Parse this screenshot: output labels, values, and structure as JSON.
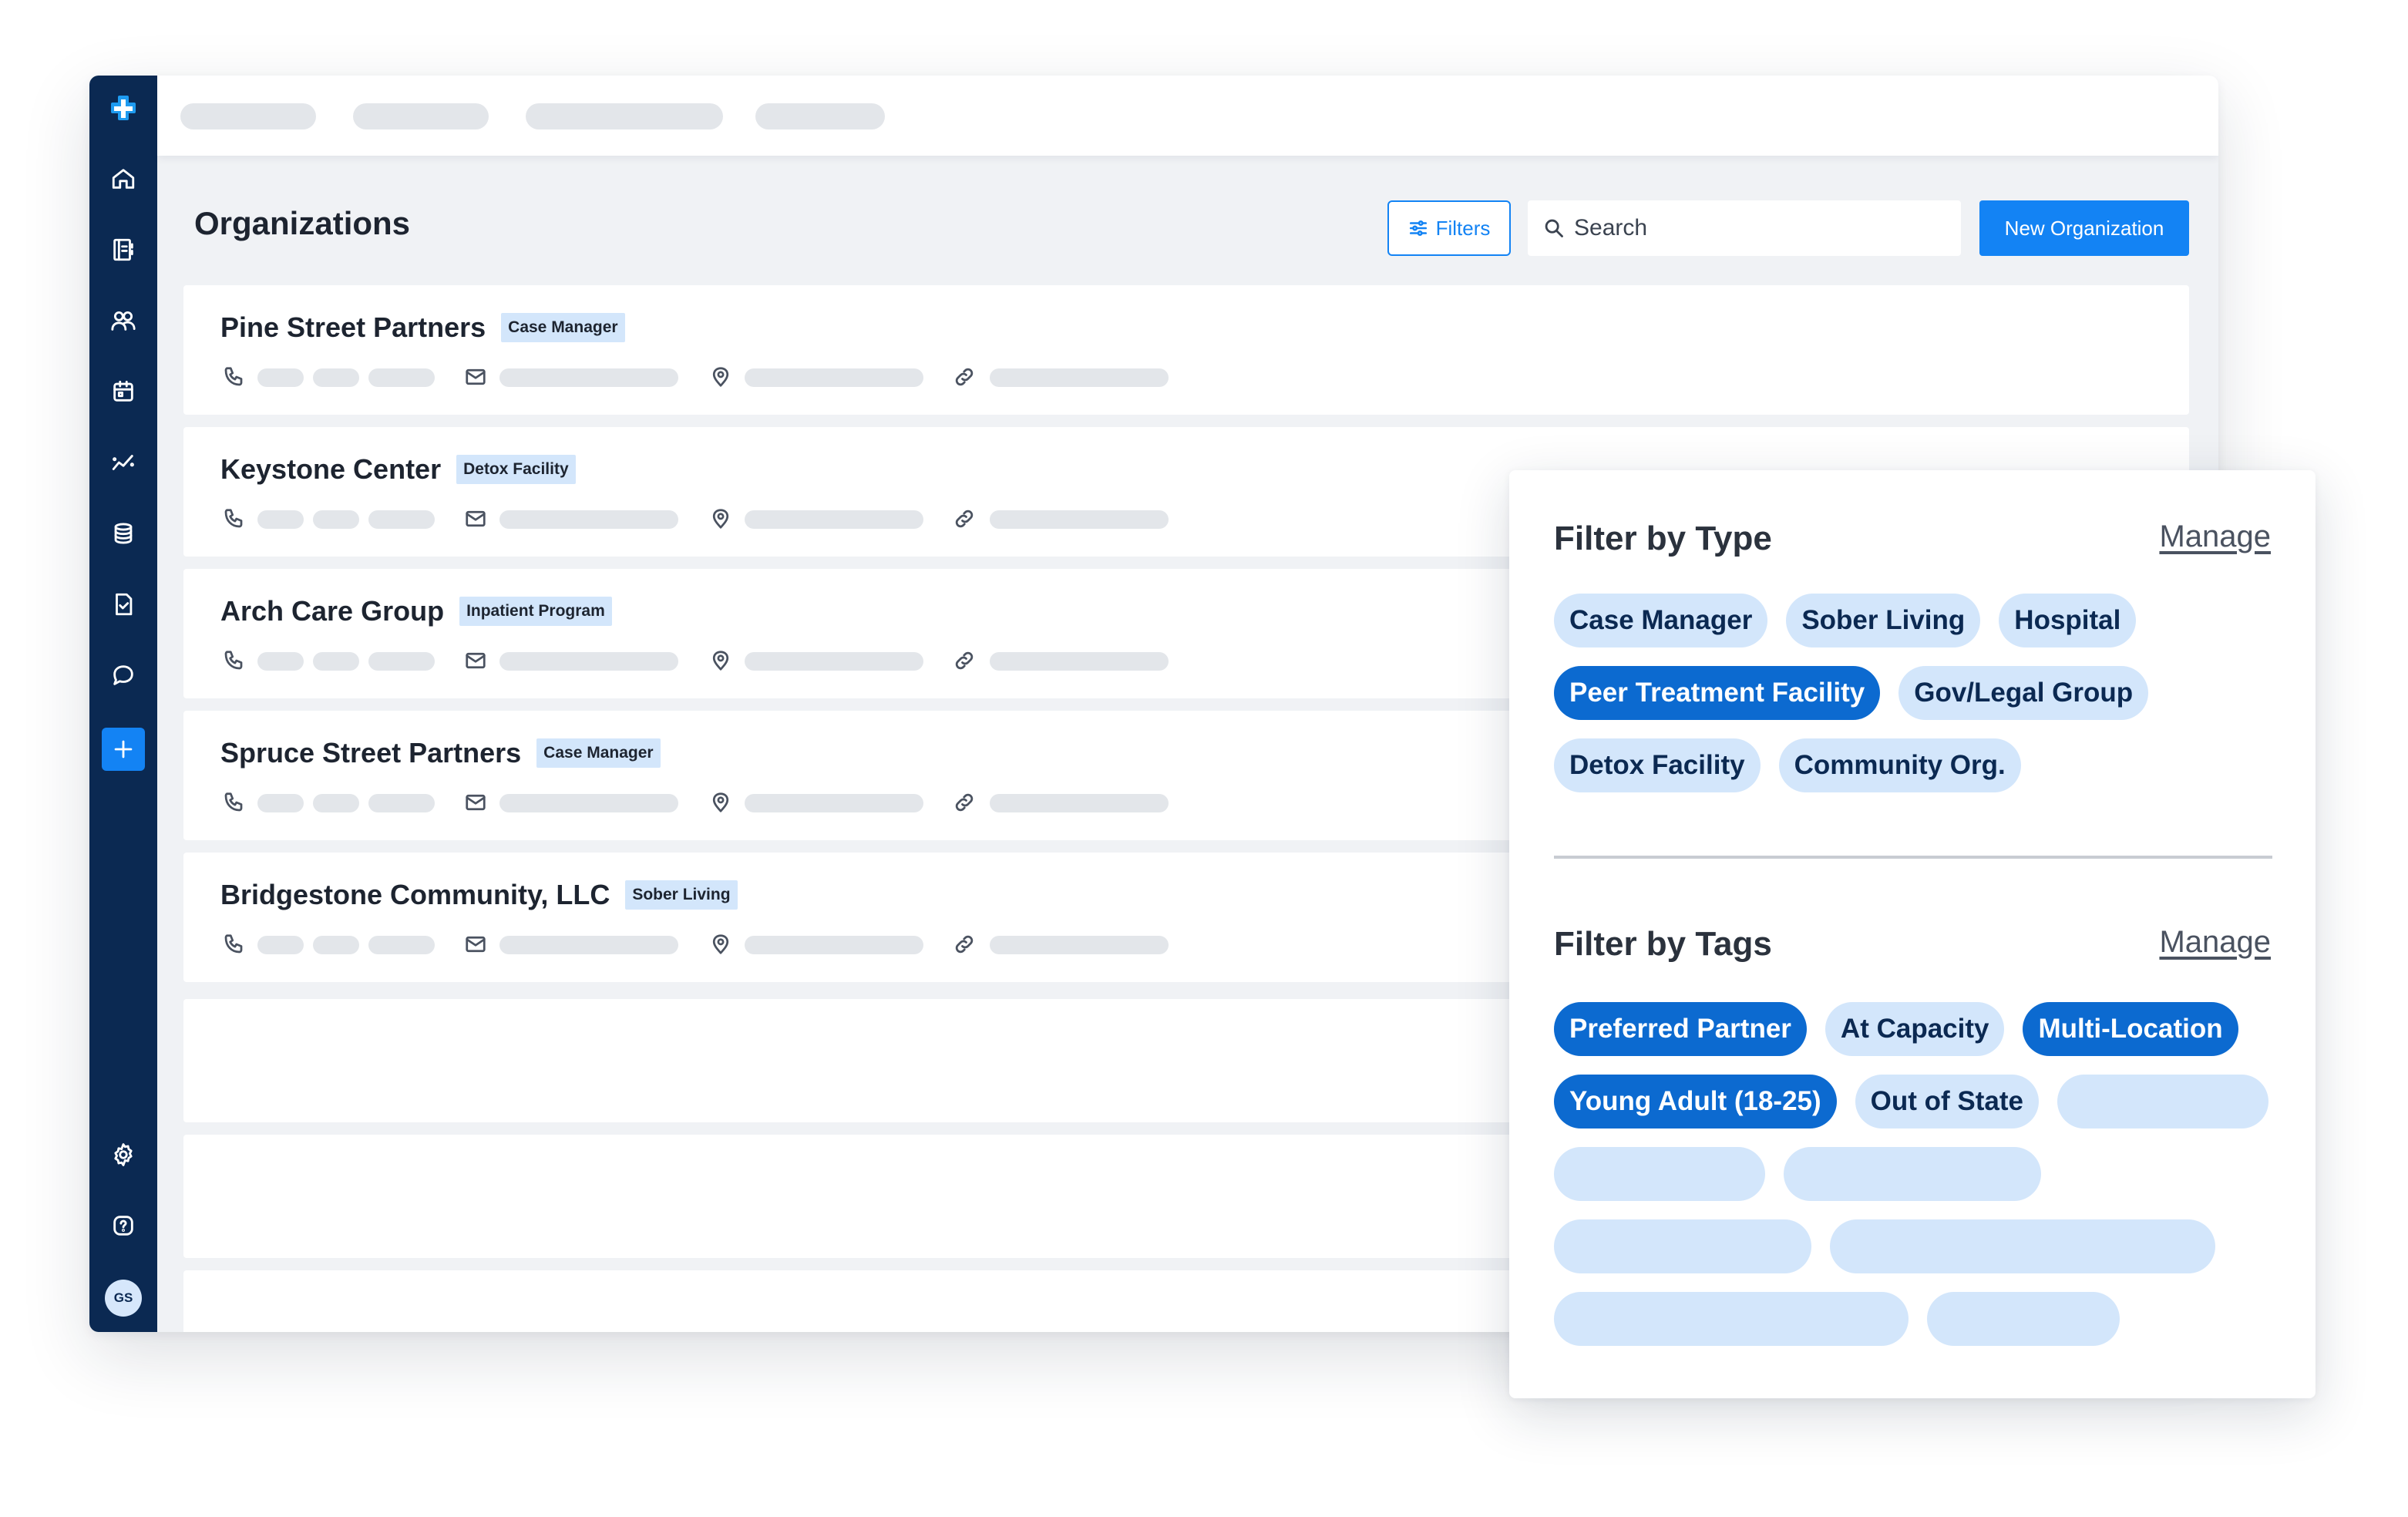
{
  "page": {
    "title": "Organizations"
  },
  "toolbar": {
    "filters_label": "Filters",
    "search_placeholder": "Search",
    "new_label": "New Organization"
  },
  "sidebar": {
    "items": [
      {
        "icon": "home-icon"
      },
      {
        "icon": "contacts-book-icon"
      },
      {
        "icon": "people-icon"
      },
      {
        "icon": "calendar-icon"
      },
      {
        "icon": "analytics-icon"
      },
      {
        "icon": "database-icon"
      },
      {
        "icon": "document-check-icon"
      },
      {
        "icon": "chat-icon"
      },
      {
        "icon": "plus-icon"
      }
    ],
    "bottom": [
      {
        "icon": "gear-icon"
      },
      {
        "icon": "help-icon"
      }
    ],
    "avatar_initials": "GS"
  },
  "organizations": [
    {
      "name": "Pine Street Partners",
      "type": "Case Manager"
    },
    {
      "name": "Keystone Center",
      "type": "Detox Facility"
    },
    {
      "name": "Arch Care Group",
      "type": "Inpatient Program"
    },
    {
      "name": "Spruce Street Partners",
      "type": "Case Manager"
    },
    {
      "name": "Bridgestone Community, LLC",
      "type": "Sober Living"
    }
  ],
  "filter_panel": {
    "type_section": {
      "title": "Filter by Type",
      "manage": "Manage",
      "chips": [
        {
          "label": "Case Manager",
          "selected": false
        },
        {
          "label": "Sober Living",
          "selected": false
        },
        {
          "label": "Hospital",
          "selected": false
        },
        {
          "label": "Peer Treatment Facility",
          "selected": true
        },
        {
          "label": "Gov/Legal Group",
          "selected": false
        },
        {
          "label": "Detox Facility",
          "selected": false
        },
        {
          "label": "Community Org.",
          "selected": false
        }
      ]
    },
    "tags_section": {
      "title": "Filter by Tags",
      "manage": "Manage",
      "chips": [
        {
          "label": "Preferred Partner",
          "selected": true
        },
        {
          "label": "At Capacity",
          "selected": false
        },
        {
          "label": "Multi-Location",
          "selected": true
        },
        {
          "label": "Young Adult (18-25)",
          "selected": true
        },
        {
          "label": "Out of State",
          "selected": false
        }
      ]
    }
  },
  "colors": {
    "sidebar": "#0b2952",
    "accent": "#1383f4",
    "chip_selected": "#0c6ad0",
    "chip_default": "#d3e6fb"
  }
}
